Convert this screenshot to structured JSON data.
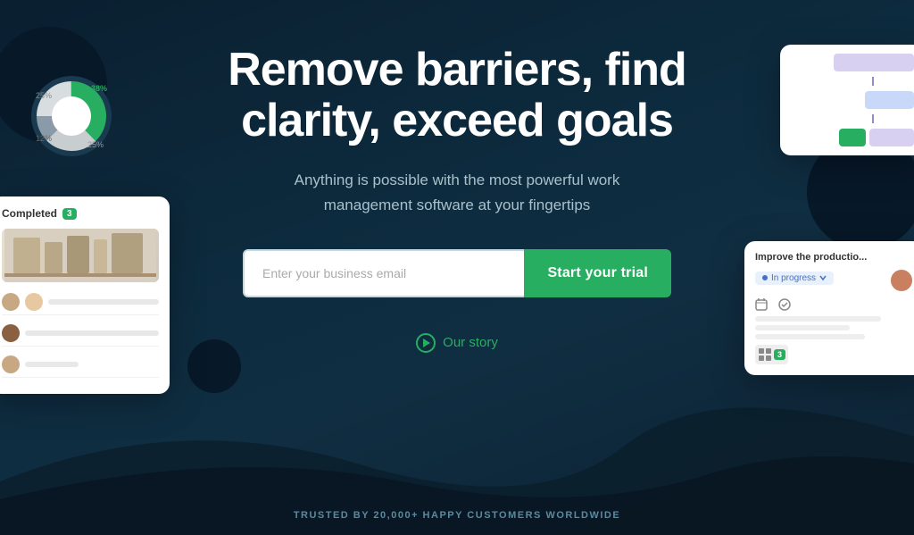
{
  "hero": {
    "title": "Remove barriers, find clarity, exceed goals",
    "subtitle": "Anything is possible with the most powerful work management software at your fingertips",
    "email_placeholder": "Enter your business email",
    "cta_label": "Start your trial",
    "story_label": "Our story",
    "trusted_text": "TRUSTED BY 20,000+ HAPPY CUSTOMERS WORLDWIDE"
  },
  "left_card": {
    "header": "Completed",
    "count": "3"
  },
  "right_bottom_card": {
    "header": "Improve the productio...",
    "status": "In progress"
  },
  "donut": {
    "segments": [
      {
        "label": "38%",
        "color": "#27ae60",
        "value": 38
      },
      {
        "label": "25%",
        "color": "#c8cdd0",
        "value": 25
      },
      {
        "label": "12%",
        "color": "#b0b8bf",
        "value": 12
      },
      {
        "label": "25%",
        "color": "#d8dde0",
        "value": 25
      }
    ]
  }
}
